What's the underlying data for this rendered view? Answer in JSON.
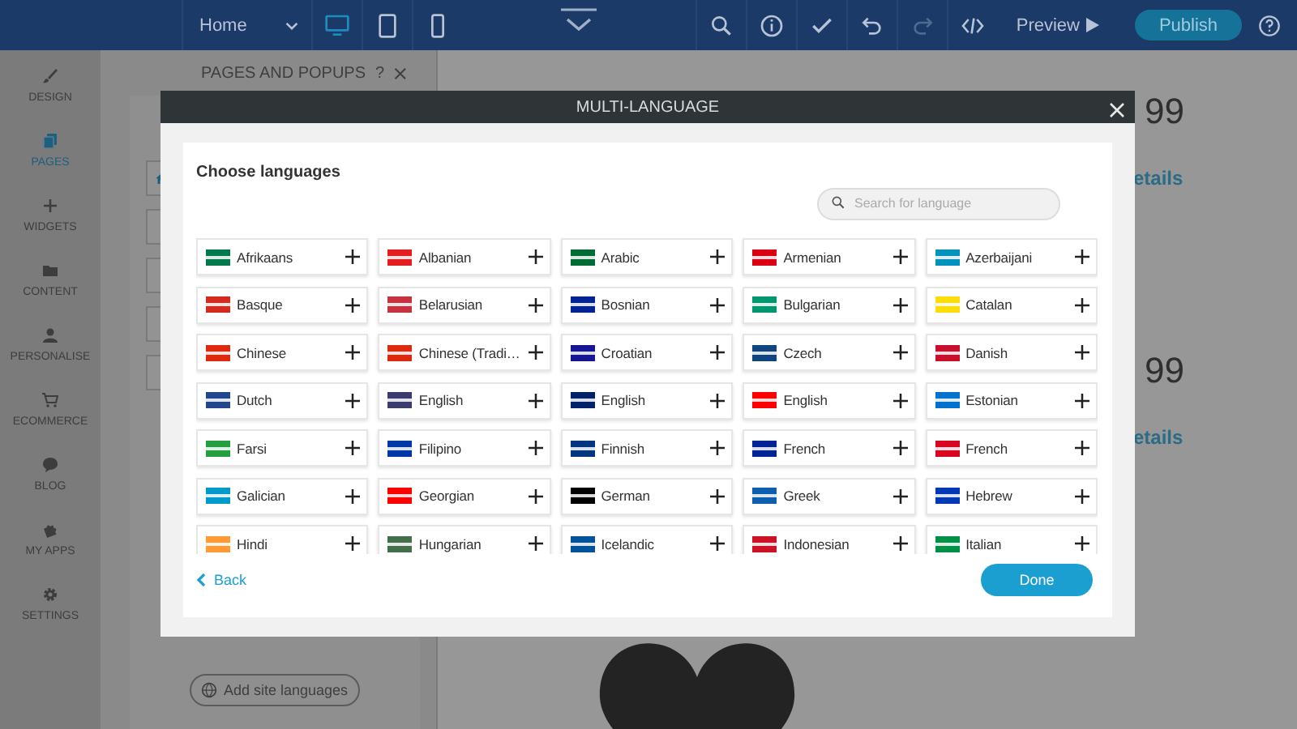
{
  "toolbar": {
    "page_select": "Home",
    "devices": [
      {
        "kind": "desktop",
        "selected": true
      },
      {
        "kind": "tablet",
        "selected": false
      },
      {
        "kind": "mobile",
        "selected": false
      }
    ],
    "actions": [
      {
        "kind": "search",
        "disabled": false
      },
      {
        "kind": "info",
        "disabled": false
      },
      {
        "kind": "check",
        "disabled": false
      },
      {
        "kind": "undo",
        "disabled": false
      },
      {
        "kind": "redo",
        "disabled": true
      },
      {
        "kind": "code",
        "disabled": false
      }
    ],
    "preview": "Preview",
    "publish": "Publish"
  },
  "sidebar": {
    "items": [
      {
        "kind": "design",
        "label": "DESIGN",
        "selected": false
      },
      {
        "kind": "pages",
        "label": "PAGES",
        "selected": true
      },
      {
        "kind": "widgets",
        "label": "WIDGETS",
        "selected": false
      },
      {
        "kind": "content",
        "label": "CONTENT",
        "selected": false
      },
      {
        "kind": "personalise",
        "label": "PERSONALISE",
        "selected": false
      },
      {
        "kind": "ecommerce",
        "label": "ECOMMERCE",
        "selected": false
      },
      {
        "kind": "blog",
        "label": "BLOG",
        "selected": false
      },
      {
        "kind": "apps",
        "label": "MY APPS",
        "selected": false
      },
      {
        "kind": "settings",
        "label": "SETTINGS",
        "selected": false
      }
    ]
  },
  "pages_panel": {
    "title": "PAGES AND POPUPS",
    "help": "?",
    "pages": [
      {
        "kind": "home"
      },
      {
        "kind": "page"
      },
      {
        "kind": "page"
      },
      {
        "kind": "page"
      },
      {
        "kind": "page"
      }
    ],
    "add_languages": "Add site languages"
  },
  "canvas": {
    "prices": [
      "99",
      "99"
    ],
    "links": [
      "etails",
      "etails"
    ]
  },
  "dialog": {
    "title": "MULTI-LANGUAGE",
    "heading": "Choose languages",
    "search": {
      "placeholder": "Search for language"
    },
    "languages": [
      {
        "name": "Afrikaans",
        "color": "#007a4d"
      },
      {
        "name": "Albanian",
        "color": "#e41e20"
      },
      {
        "name": "Arabic",
        "color": "#006c35"
      },
      {
        "name": "Armenian",
        "color": "#d90012"
      },
      {
        "name": "Azerbaijani",
        "color": "#0092bc"
      },
      {
        "name": "Basque",
        "color": "#d52b1e"
      },
      {
        "name": "Belarusian",
        "color": "#c8313e"
      },
      {
        "name": "Bosnian",
        "color": "#002395"
      },
      {
        "name": "Bulgarian",
        "color": "#00966e"
      },
      {
        "name": "Catalan",
        "color": "#fcdd09"
      },
      {
        "name": "Chinese",
        "color": "#de2910"
      },
      {
        "name": "Chinese (Tradi…",
        "color": "#de2911"
      },
      {
        "name": "Croatian",
        "color": "#171796"
      },
      {
        "name": "Czech",
        "color": "#11457e"
      },
      {
        "name": "Danish",
        "color": "#c8102e"
      },
      {
        "name": "Dutch",
        "color": "#21468b"
      },
      {
        "name": "English",
        "color": "#3c3b6e"
      },
      {
        "name": "English",
        "color": "#012169"
      },
      {
        "name": "English",
        "color": "#ff0000"
      },
      {
        "name": "Estonian",
        "color": "#0072ce"
      },
      {
        "name": "Farsi",
        "color": "#239f40"
      },
      {
        "name": "Filipino",
        "color": "#0038a8"
      },
      {
        "name": "Finnish",
        "color": "#003580"
      },
      {
        "name": "French",
        "color": "#002395"
      },
      {
        "name": "French",
        "color": "#d80621"
      },
      {
        "name": "Galician",
        "color": "#0099cc"
      },
      {
        "name": "Georgian",
        "color": "#ff0001"
      },
      {
        "name": "German",
        "color": "#000000"
      },
      {
        "name": "Greek",
        "color": "#0d5eaf"
      },
      {
        "name": "Hebrew",
        "color": "#0038b8"
      },
      {
        "name": "Hindi",
        "color": "#ff9933"
      },
      {
        "name": "Hungarian",
        "color": "#436f4d"
      },
      {
        "name": "Icelandic",
        "color": "#02529c"
      },
      {
        "name": "Indonesian",
        "color": "#ce1126"
      },
      {
        "name": "Italian",
        "color": "#009246"
      }
    ],
    "back": "Back",
    "done": "Done"
  }
}
